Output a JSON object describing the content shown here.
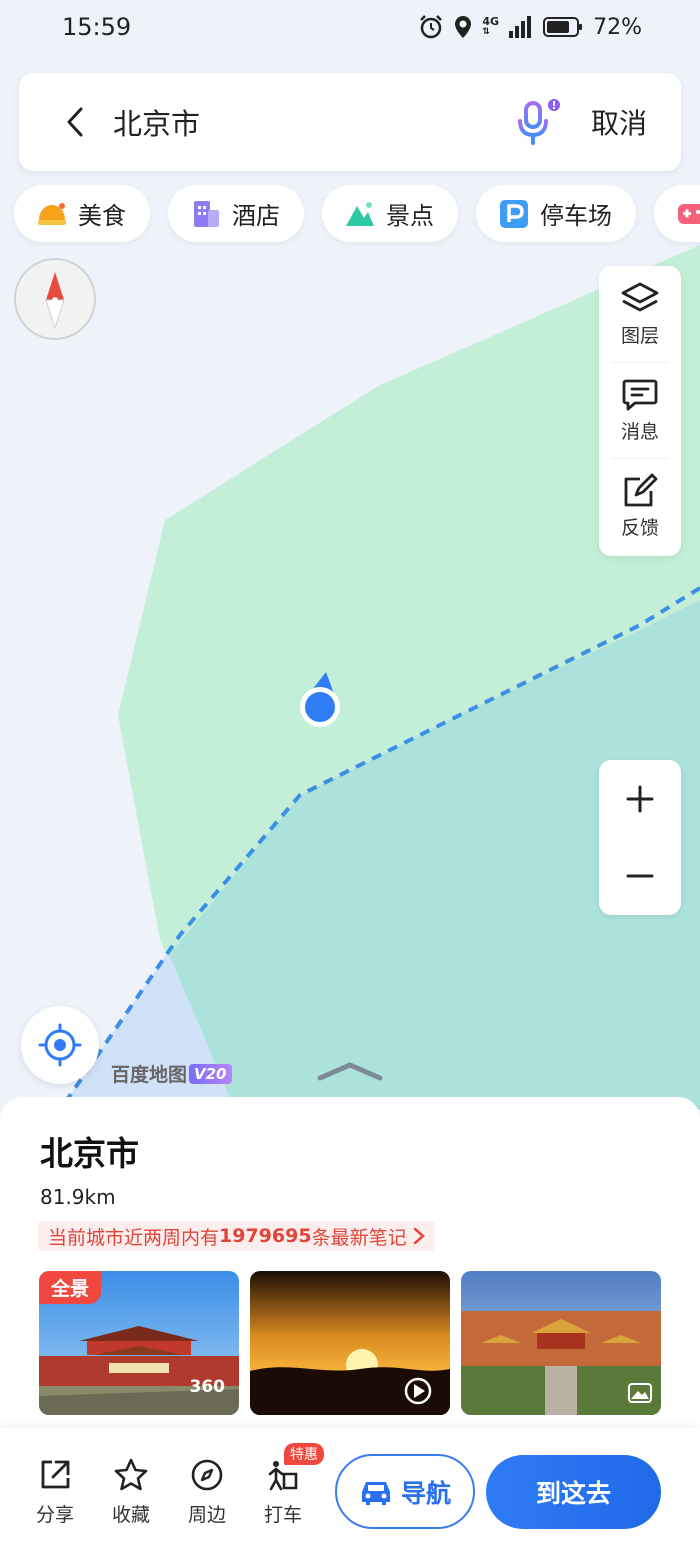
{
  "status_bar": {
    "time": "15:59",
    "network": "4G",
    "battery": "72%"
  },
  "search": {
    "query": "北京市",
    "cancel_label": "取消"
  },
  "categories": [
    {
      "label": "美食",
      "icon": "food-icon"
    },
    {
      "label": "酒店",
      "icon": "hotel-icon"
    },
    {
      "label": "景点",
      "icon": "scenic-icon"
    },
    {
      "label": "停车场",
      "icon": "parking-icon"
    }
  ],
  "side_panel": [
    {
      "label": "图层",
      "icon": "layers-icon"
    },
    {
      "label": "消息",
      "icon": "message-icon"
    },
    {
      "label": "反馈",
      "icon": "feedback-icon"
    }
  ],
  "map": {
    "logo_text": "百度地图",
    "logo_version": "V20"
  },
  "place": {
    "name": "北京市",
    "distance": "81.9km",
    "notes_prefix": "当前城市近两周内有",
    "notes_count": "1979695",
    "notes_suffix": "条最新笔记",
    "photos": [
      {
        "badge": "全景",
        "overlay": "360"
      },
      {
        "badge": "",
        "overlay": "play-icon"
      },
      {
        "badge": "",
        "overlay": "image-icon"
      }
    ]
  },
  "actions": [
    {
      "label": "分享",
      "icon": "share-icon"
    },
    {
      "label": "收藏",
      "icon": "star-icon"
    },
    {
      "label": "周边",
      "icon": "compass-icon"
    },
    {
      "label": "打车",
      "icon": "taxi-icon",
      "badge": "特惠"
    }
  ],
  "nav_label": "导航",
  "go_label": "到这去",
  "colors": {
    "accent": "#2a6ff0",
    "map_green": "#c3efd9",
    "map_teal": "#abe3dc",
    "badge_red": "#f0483e"
  }
}
